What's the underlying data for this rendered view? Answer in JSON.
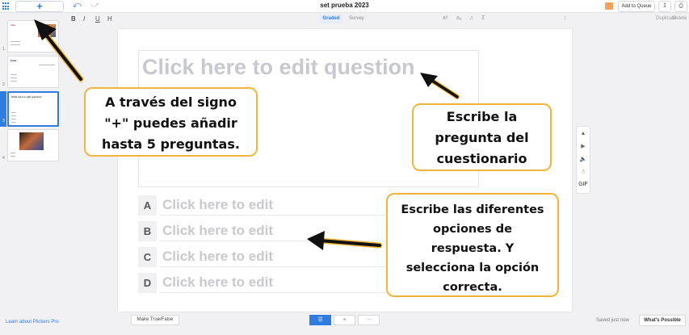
{
  "toolbar": {
    "add_label": "+",
    "doc_title": "set prueba 2023",
    "add_to_queue": "Add to Queue",
    "download_icon": "download-icon",
    "print_icon": "print-icon"
  },
  "format": {
    "bold": "B",
    "italic": "I",
    "underline": "U",
    "heading": "H",
    "tab_graded": "Graded",
    "tab_survey": "Survey",
    "sigma": "Σ",
    "duplicate": "Duplicate",
    "delete": "Delete"
  },
  "sidebar": {
    "slides": [
      {
        "num": "1",
        "title": "plan"
      },
      {
        "num": "2",
        "title": "Edad"
      },
      {
        "num": "3",
        "title": "Click here to edit question"
      },
      {
        "num": "4",
        "title": ""
      }
    ],
    "learn_link": "Learn about Plickers Pro"
  },
  "editor": {
    "question_placeholder": "Click here to edit question",
    "choices": [
      {
        "letter": "A",
        "text": "Click here to edit"
      },
      {
        "letter": "B",
        "text": "Click here to edit"
      },
      {
        "letter": "C",
        "text": "Click here to edit"
      },
      {
        "letter": "D",
        "text": "Click here to edit"
      }
    ]
  },
  "media": {
    "gif_label": "GIF"
  },
  "footer": {
    "make_true_false": "Make True/False",
    "saved_status": "Saved just now",
    "whats_possible": "What's Possible"
  },
  "annotations": {
    "callout_add": [
      "A través del signo",
      "\"+\" puedes añadir",
      "hasta 5 preguntas."
    ],
    "callout_question": [
      "Escribe la",
      "pregunta del",
      "cuestionario"
    ],
    "callout_options": [
      "Escribe las diferentes",
      "opciones de",
      "respuesta. Y",
      "selecciona la opción",
      "correcta."
    ]
  },
  "colors": {
    "accent": "#2f7de1",
    "callout_border": "#f2b53c",
    "placeholder": "#c8c8d0"
  }
}
